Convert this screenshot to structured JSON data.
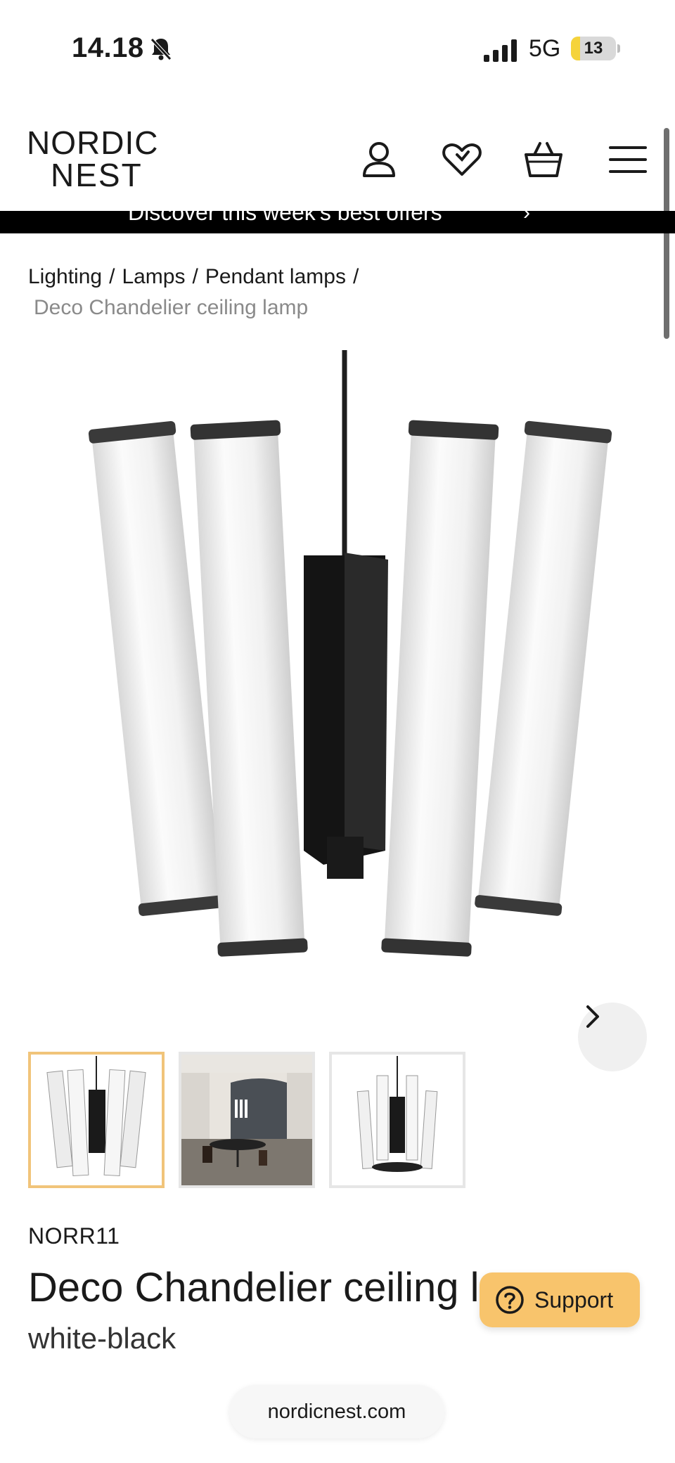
{
  "status_bar": {
    "time": "14.18",
    "network": "5G",
    "battery_level": "13",
    "battery_fraction": 0.2
  },
  "header": {
    "logo_line1": "NORDIC",
    "logo_line2": "NEST",
    "icons": [
      "account-icon",
      "wishlist-icon",
      "cart-icon",
      "menu-icon"
    ]
  },
  "promo": {
    "text": "Discover this week's best offers"
  },
  "breadcrumb": {
    "items": [
      "Lighting",
      "Lamps",
      "Pendant lamps"
    ],
    "separator": "/",
    "current": "Deco Chandelier ceiling lamp"
  },
  "product": {
    "brand_code": "NORR11",
    "title": "Deco Chandelier ceiling lamp",
    "variant": "white-black",
    "thumbnail_count": 3,
    "active_thumbnail": 1
  },
  "support": {
    "label": "Support"
  },
  "browser": {
    "url": "nordicnest.com"
  },
  "colors": {
    "accent_yellow": "#f8c46c",
    "active_thumb_border": "#f1c47a",
    "banner_bg": "#000000",
    "muted_text": "#8a8a8a"
  }
}
